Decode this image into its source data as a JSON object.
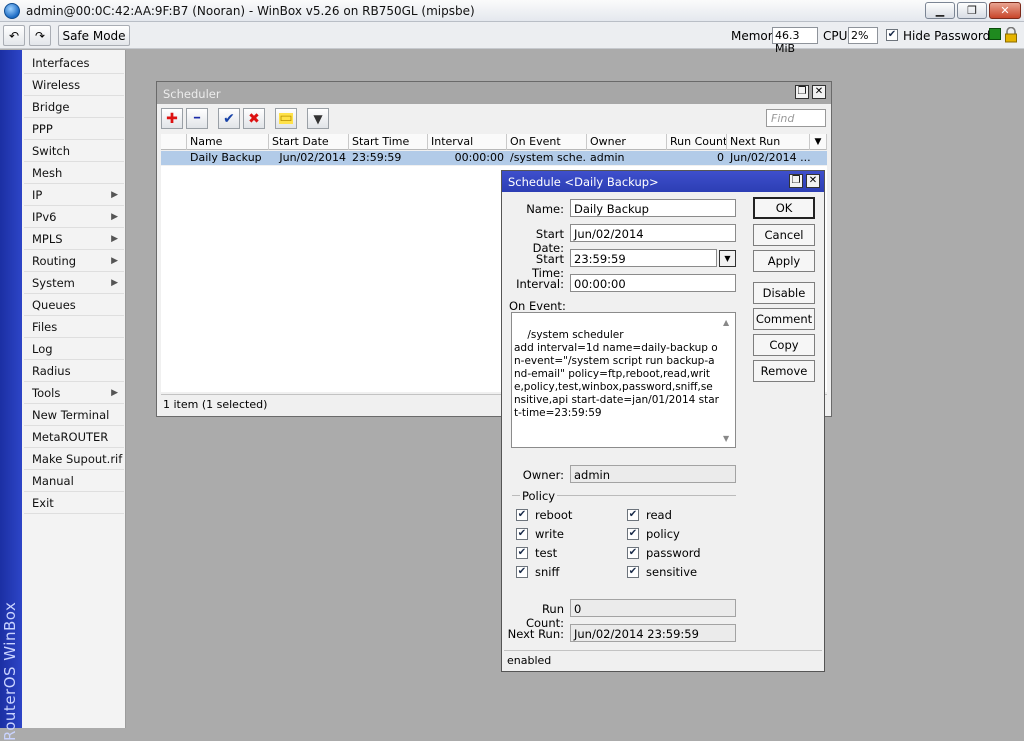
{
  "window": {
    "title": "admin@00:0C:42:AA:9F:B7 (Nooran) - WinBox v5.26 on RB750GL (mipsbe)",
    "minimize_glyph": "▁",
    "maximize_glyph": "❐",
    "close_glyph": "✕"
  },
  "toolbar": {
    "undo_glyph": "↶",
    "redo_glyph": "↷",
    "safe_mode_label": "Safe Mode",
    "memory_label": "Memory:",
    "memory_value": "46.3 MiB",
    "cpu_label": "CPU:",
    "cpu_value": "2%",
    "hide_passwords_label": "Hide Passwords",
    "hide_passwords_checked": "✔",
    "status_indicator_color": "#1f8a1f"
  },
  "brand": {
    "text": "RouterOS WinBox"
  },
  "menu": {
    "items": [
      {
        "label": "Interfaces"
      },
      {
        "label": "Wireless"
      },
      {
        "label": "Bridge"
      },
      {
        "label": "PPP"
      },
      {
        "label": "Switch"
      },
      {
        "label": "Mesh"
      },
      {
        "label": "IP"
      },
      {
        "label": "IPv6"
      },
      {
        "label": "MPLS"
      },
      {
        "label": "Routing"
      },
      {
        "label": "System"
      },
      {
        "label": "Queues"
      },
      {
        "label": "Files"
      },
      {
        "label": "Log"
      },
      {
        "label": "Radius"
      },
      {
        "label": "Tools"
      },
      {
        "label": "New Terminal"
      },
      {
        "label": "MetaROUTER"
      },
      {
        "label": "Make Supout.rif"
      },
      {
        "label": "Manual"
      },
      {
        "label": "Exit"
      }
    ],
    "submenu_arrow": "▶"
  },
  "scheduler": {
    "title": "Scheduler",
    "restore_glyph": "❐",
    "close_glyph": "✕",
    "tools": {
      "add_glyph": "✚",
      "remove_glyph": "━",
      "enable_glyph": "✔",
      "disable_glyph": "✖",
      "comment_glyph": "▭",
      "filter_glyph": "▼"
    },
    "find_placeholder": "Find",
    "columns": [
      "Name",
      "Start Date",
      "Start Time",
      "Interval",
      "On Event",
      "Owner",
      "Run Count",
      "Next Run"
    ],
    "column_menu_glyph": "▼",
    "rows": [
      {
        "name": "Daily Backup",
        "start_date": "Jun/02/2014",
        "start_time": "23:59:59",
        "interval": "00:00:00",
        "on_event": "/system sche...",
        "owner": "admin",
        "run_count": "0",
        "next_run": "Jun/02/2014 ..."
      }
    ],
    "status": "1 item (1 selected)"
  },
  "dialog": {
    "title": "Schedule <Daily Backup>",
    "restore_glyph": "❐",
    "close_glyph": "✕",
    "name_label": "Name:",
    "name_value": "Daily Backup",
    "start_date_label": "Start Date:",
    "start_date_value": "Jun/02/2014",
    "start_time_label": "Start Time:",
    "start_time_value": "23:59:59",
    "start_time_dropdown_glyph": "▼",
    "interval_label": "Interval:",
    "interval_value": "00:00:00",
    "on_event_label": "On Event:",
    "on_event_value": "/system scheduler\nadd interval=1d name=daily-backup on-event=\"/system script run backup-and-email\" policy=ftp,reboot,read,write,policy,test,winbox,password,sniff,sensitive,api start-date=jan/01/2014 start-time=23:59:59",
    "scroll_up_glyph": "▲",
    "scroll_down_glyph": "▼",
    "owner_label": "Owner:",
    "owner_value": "admin",
    "policy_label": "Policy",
    "policies": [
      {
        "label": "reboot",
        "checked": "✔"
      },
      {
        "label": "read",
        "checked": "✔"
      },
      {
        "label": "write",
        "checked": "✔"
      },
      {
        "label": "policy",
        "checked": "✔"
      },
      {
        "label": "test",
        "checked": "✔"
      },
      {
        "label": "password",
        "checked": "✔"
      },
      {
        "label": "sniff",
        "checked": "✔"
      },
      {
        "label": "sensitive",
        "checked": "✔"
      }
    ],
    "run_count_label": "Run Count:",
    "run_count_value": "0",
    "next_run_label": "Next Run:",
    "next_run_value": "Jun/02/2014 23:59:59",
    "buttons": {
      "ok": "OK",
      "cancel": "Cancel",
      "apply": "Apply",
      "disable": "Disable",
      "comment": "Comment",
      "copy": "Copy",
      "remove": "Remove"
    },
    "status": "enabled"
  }
}
